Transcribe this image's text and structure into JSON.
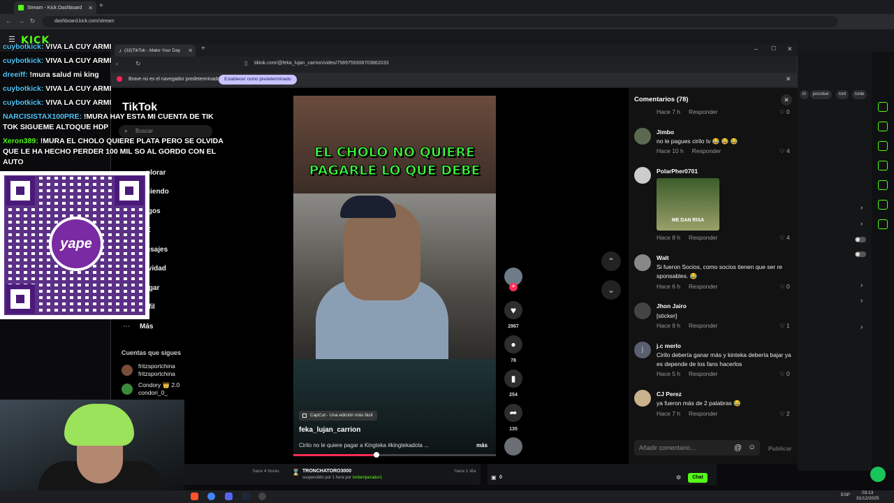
{
  "outer_browser": {
    "tab_title": "Stream - Kick Dashboard",
    "url": "dashboard.kick.com/stream",
    "logo": "KICK"
  },
  "stream_chat": {
    "lines": [
      {
        "user": "cuybotkick:",
        "text": "VIVA LA CUY ARMI"
      },
      {
        "user": "cuybotkick:",
        "text": "VIVA LA CUY ARMI"
      },
      {
        "user": "dreeiff:",
        "text": "!mura salud mi king"
      },
      {
        "user": "cuybotkick:",
        "text": "VIVA LA CUY ARMI"
      },
      {
        "user": "cuybotkick:",
        "text": "VIVA LA CUY ARMI"
      }
    ],
    "msg_narcisista_user": "NARCISISTAX100PRE:",
    "msg_narcisista_1": "!MURA HAY ESTA MI CUENTA DE TIK",
    "msg_narcisista_2": "TOK SIGUEME ALTOQUE HDP",
    "msg_xeron_user": "Xeron389:",
    "msg_xeron_1": "!MURA EL CHOLO QUIERE PLATA PERO SE OLVIDA",
    "msg_xeron_2": "QUE LE HA HECHO PERDER 100 MIL SO AL GORDO CON EL",
    "msg_xeron_3": "AUTO"
  },
  "qr_logo": "yape",
  "inner_browser": {
    "tab_title": "(33)TikTok - Make Your Day",
    "url": "tiktok.com/@feka_lujan_carrion/video/7589759308703862033",
    "brave_message": "Brave no es el navegador predeterminado",
    "brave_button": "Establecer como predeterminado"
  },
  "tiktok": {
    "logo": "TikTok",
    "search_placeholder": "Buscar",
    "nav": [
      "plorar",
      "uiendo",
      "igos",
      "E",
      "nsajes",
      "ividad",
      "rgar",
      "rfil"
    ],
    "nav_more": "Más",
    "following_title": "Cuentas que sigues",
    "following": [
      {
        "name": "fritzsportchina",
        "handle": "fritzsportchina"
      },
      {
        "name": "Condory 👑 2.0",
        "handle": "condori_0_"
      }
    ]
  },
  "video": {
    "caption": "EL CHOLO NO QUIERE PAGARLE LO QUE DEBE",
    "capcut_badge": "CapCut - Una edición más fácil",
    "author": "feka_lujan_carrion",
    "description": "Cirilo no le quiere pagar a Kingteka #kingtekadota ...",
    "more": "más",
    "progress": 0.41,
    "likes": "2967",
    "comments": "78",
    "saves": "254",
    "shares": "135"
  },
  "comments_panel": {
    "title": "Comentarios (78)",
    "top_meta": {
      "time": "Hace 7 h",
      "reply": "Responder",
      "likes": "0"
    },
    "items": [
      {
        "user": "Jimbo",
        "text": "no le pagues cirilo tv 😂 😂 😂",
        "time": "Hace 10 h",
        "reply": "Responder",
        "likes": "4"
      },
      {
        "user": "PolarPher0701",
        "text": "",
        "image_label": "ME DAN RISA",
        "time": "Hace 8 h",
        "reply": "Responder",
        "likes": "4"
      },
      {
        "user": "Walt",
        "text": "Si fueron Socios, como socios tienen que ser re sponsables. 😂",
        "time": "Hace 6 h",
        "reply": "Responder",
        "likes": "0"
      },
      {
        "user": "Jhon Jairo",
        "text": "[sticker]",
        "time": "Hace 9 h",
        "reply": "Responder",
        "likes": "1"
      },
      {
        "user": "j.c merlo",
        "text": "Cirilo debería ganar más y kinteka debería bajar ya es depende de los fans hacerlos",
        "time": "Hace 5 h",
        "reply": "Responder",
        "likes": "0"
      },
      {
        "user": "CJ Perez",
        "text": "ya fueron más de 2 palabras 😂",
        "time": "Hace 7 h",
        "reply": "Responder",
        "likes": "2"
      }
    ],
    "input_placeholder": "Añadir comentario...",
    "publish": "Publicar"
  },
  "dashboard": {
    "tags": [
      "irl",
      "jescobar",
      "lord",
      "lorde"
    ],
    "bottom_card1_time": "hace 4 horas",
    "bottom_card2_user": "TRONCHATORO3000",
    "bottom_card2_text": "suspendido por 1 hora por",
    "bottom_card2_by": "lordemperador1",
    "bottom_card2_time": "hace 1 día",
    "viewers": "0",
    "chat_button": "Chat"
  },
  "taskbar": {
    "lang": "ESP",
    "time": "03:13",
    "date": "31/12/2025"
  },
  "colors": {
    "kick_green": "#53fc18",
    "tiktok_red": "#fe2c55",
    "caption_green": "#3cff3c"
  }
}
